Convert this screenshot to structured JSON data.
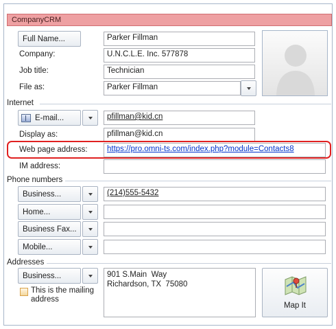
{
  "titlebar": {
    "title": "CompanyCRM"
  },
  "name": {
    "button": "Full Name...",
    "value": "Parker Fillman"
  },
  "company": {
    "label": "Company:",
    "value": "U.N.C.L.E. Inc. 577878"
  },
  "job_title": {
    "label": "Job title:",
    "value": "Technician"
  },
  "file_as": {
    "label": "File as:",
    "value": "Parker Fillman"
  },
  "internet": {
    "section": "Internet",
    "email_button": "E-mail...",
    "email_value": "pfillman@kid.cn",
    "display_as_label": "Display as:",
    "display_as_value": "pfillman@kid.cn",
    "web_label": "Web page address:",
    "web_value": "https://pro.omni-ts.com/index.php?module=Contacts8",
    "im_label": "IM address:",
    "im_value": ""
  },
  "phones": {
    "section": "Phone numbers",
    "items": [
      {
        "button": "Business...",
        "value": "(214)555-5432"
      },
      {
        "button": "Home...",
        "value": ""
      },
      {
        "button": "Business Fax...",
        "value": ""
      },
      {
        "button": "Mobile...",
        "value": ""
      }
    ]
  },
  "addresses": {
    "section": "Addresses",
    "button": "Business...",
    "value": "901 S.Main  Way\nRichardson, TX  75080",
    "mailing_label": "This is the mailing address",
    "map_button": "Map It"
  },
  "colors": {
    "title_bar": "#eea0a2",
    "highlight": "#e02020",
    "link": "#0033cc"
  },
  "icons": {
    "email": "address-book-icon",
    "photo": "contact-silhouette-icon",
    "map": "map-pin-icon"
  }
}
